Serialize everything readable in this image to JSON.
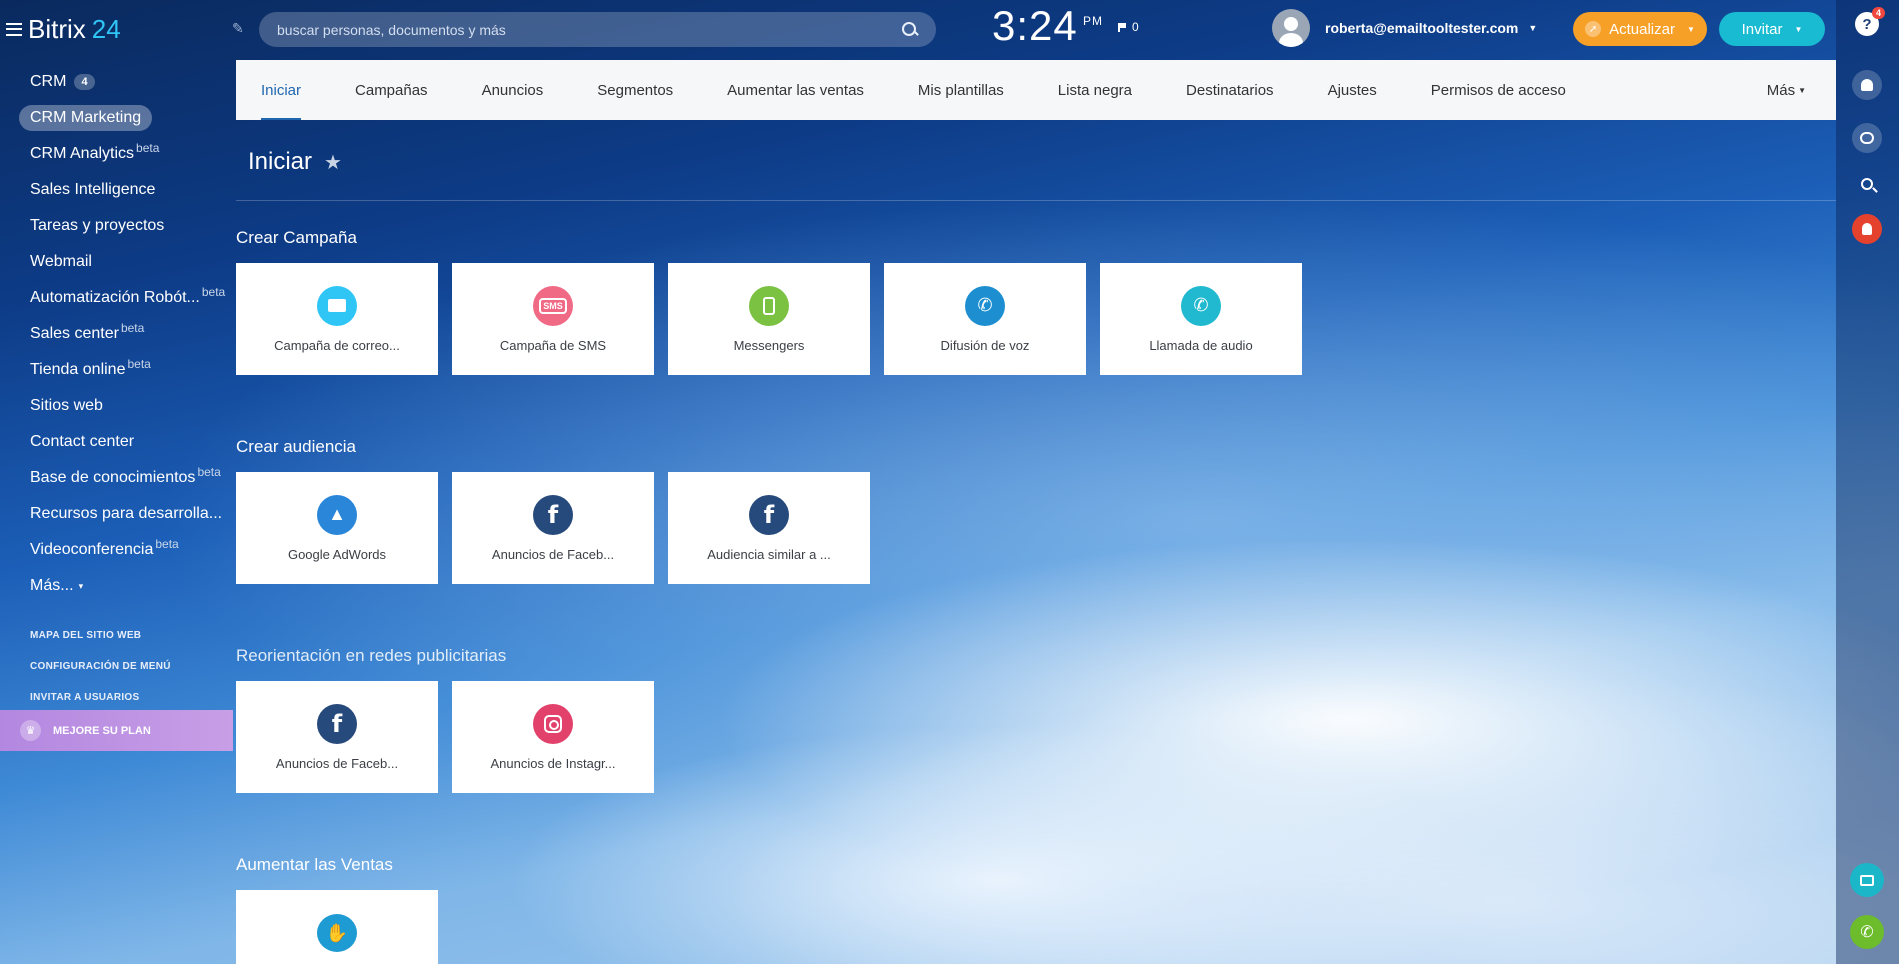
{
  "app": {
    "brand": "Bitrix",
    "brand_num": "24"
  },
  "sidebar": {
    "items": [
      {
        "label": "CRM",
        "badge": "4"
      },
      {
        "label": "CRM Marketing"
      },
      {
        "label": "CRM Analytics",
        "sup": "beta"
      },
      {
        "label": "Sales Intelligence"
      },
      {
        "label": "Tareas y proyectos"
      },
      {
        "label": "Webmail"
      },
      {
        "label": "Automatización Robót...",
        "sup": "beta"
      },
      {
        "label": "Sales center",
        "sup": "beta"
      },
      {
        "label": "Tienda online",
        "sup": "beta"
      },
      {
        "label": "Sitios web"
      },
      {
        "label": "Contact center"
      },
      {
        "label": "Base de conocimientos",
        "sup": "beta"
      },
      {
        "label": "Recursos para desarrolla..."
      },
      {
        "label": "Videoconferencia",
        "sup": "beta"
      },
      {
        "label": "Más..."
      }
    ],
    "links": [
      "MAPA DEL SITIO WEB",
      "CONFIGURACIÓN DE MENÚ",
      "INVITAR A USUARIOS"
    ],
    "upgrade": "MEJORE SU PLAN"
  },
  "topbar": {
    "search_placeholder": "buscar personas, documentos y más",
    "clock": "3:24",
    "ampm": "PM",
    "flag_count": "0",
    "user_email": "roberta@emailtooltester.com",
    "upgrade_label": "Actualizar",
    "invite_label": "Invitar"
  },
  "rail": {
    "help_badge": "4"
  },
  "tabs": {
    "items": [
      "Iniciar",
      "Campañas",
      "Anuncios",
      "Segmentos",
      "Aumentar las ventas",
      "Mis plantillas",
      "Lista negra",
      "Destinatarios",
      "Ajustes",
      "Permisos de acceso"
    ],
    "more": "Más"
  },
  "page": {
    "title": "Iniciar"
  },
  "sections": {
    "campaign": {
      "title": "Crear Campaña",
      "tiles": [
        "Campaña de correo...",
        "Campaña de SMS",
        "Messengers",
        "Difusión de voz",
        "Llamada de audio"
      ]
    },
    "audience": {
      "title": "Crear audiencia",
      "tiles": [
        "Google AdWords",
        "Anuncios de Faceb...",
        "Audiencia similar a ..."
      ]
    },
    "retargeting": {
      "title": "Reorientación en redes publicitarias",
      "tiles": [
        "Anuncios de Faceb...",
        "Anuncios de Instagr..."
      ]
    },
    "sales": {
      "title": "Aumentar las Ventas"
    }
  },
  "colors": {
    "email": "#2fc6f6",
    "sms": "#f06985",
    "messengers": "#7bc142",
    "voice": "#1d8fd1",
    "audio": "#20b9cf",
    "adwords": "#2a86d9",
    "facebook": "#274a7c",
    "instagram": "#e2416c",
    "sales": "#1e9bd3"
  }
}
